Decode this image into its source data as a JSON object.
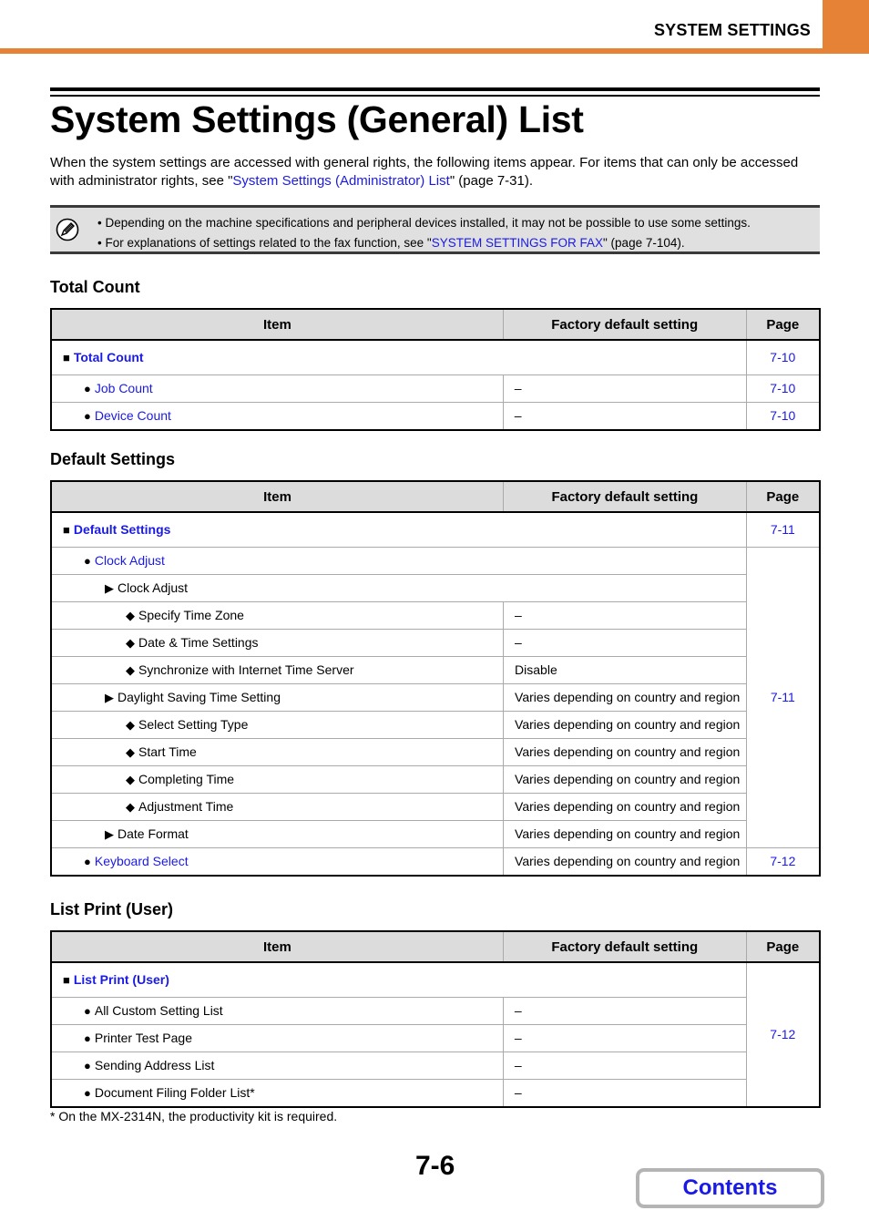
{
  "header": {
    "section": "SYSTEM SETTINGS",
    "accent_color": "#e68235"
  },
  "title": "System Settings (General) List",
  "intro": {
    "before": "When the system settings are accessed with general rights, the following items appear. For items that can only be accessed with administrator rights, see \"",
    "link": "System Settings (Administrator) List",
    "after": "\" (page 7-31)."
  },
  "note": {
    "icon": "pencil-note-icon",
    "line1": "• Depending on the machine specifications and peripheral devices installed, it may not be possible to use some settings.",
    "line2_before": "• For explanations of settings related to the fax function, see \"",
    "line2_link": "SYSTEM SETTINGS FOR FAX",
    "line2_after": "\" (page 7-104)."
  },
  "columns": {
    "item": "Item",
    "default": "Factory default setting",
    "page": "Page"
  },
  "sections": {
    "total_count": {
      "heading": "Total Count",
      "rows": [
        {
          "level": 0,
          "glyph": "■",
          "label": "Total Count",
          "link": true,
          "page": "7-10"
        },
        {
          "level": 1,
          "glyph": "●",
          "label": "Job Count",
          "link": true,
          "default": "–",
          "page": "7-10"
        },
        {
          "level": 1,
          "glyph": "●",
          "label": "Device Count",
          "link": true,
          "default": "–",
          "page": "7-10"
        }
      ]
    },
    "default_settings": {
      "heading": "Default Settings",
      "rows": [
        {
          "level": 0,
          "glyph": "■",
          "label": "Default Settings",
          "link": true,
          "page": "7-11"
        },
        {
          "level": 1,
          "glyph": "●",
          "label": "Clock Adjust",
          "link": true
        },
        {
          "level": 2,
          "glyph": "▶",
          "label": "Clock Adjust"
        },
        {
          "level": 3,
          "glyph": "◆",
          "label": "Specify Time Zone",
          "default": "–"
        },
        {
          "level": 3,
          "glyph": "◆",
          "label": "Date & Time Settings",
          "default": "–"
        },
        {
          "level": 3,
          "glyph": "◆",
          "label": "Synchronize with Internet Time Server",
          "default": "Disable"
        },
        {
          "level": 2,
          "glyph": "▶",
          "label": "Daylight Saving Time Setting",
          "default": "Varies depending on country and region"
        },
        {
          "level": 3,
          "glyph": "◆",
          "label": "Select Setting Type",
          "default": "Varies depending on country and region"
        },
        {
          "level": 3,
          "glyph": "◆",
          "label": "Start Time",
          "default": "Varies depending on country and region"
        },
        {
          "level": 3,
          "glyph": "◆",
          "label": "Completing Time",
          "default": "Varies depending on country and region"
        },
        {
          "level": 3,
          "glyph": "◆",
          "label": "Adjustment Time",
          "default": "Varies depending on country and region"
        },
        {
          "level": 2,
          "glyph": "▶",
          "label": "Date Format",
          "default": "Varies depending on country and region"
        },
        {
          "level": 1,
          "glyph": "●",
          "label": "Keyboard Select",
          "link": true,
          "default": "Varies depending on country and region",
          "page": "7-12"
        }
      ],
      "clock_adjust_page": "7-11"
    },
    "list_print": {
      "heading": "List Print (User)",
      "rows": [
        {
          "level": 0,
          "glyph": "■",
          "label": "List Print (User)",
          "link": true
        },
        {
          "level": 1,
          "glyph": "●",
          "label": "All Custom Setting List",
          "default": "–"
        },
        {
          "level": 1,
          "glyph": "●",
          "label": "Printer Test Page",
          "default": "–"
        },
        {
          "level": 1,
          "glyph": "●",
          "label": "Sending Address List",
          "default": "–"
        },
        {
          "level": 1,
          "glyph": "●",
          "label": "Document Filing Folder List*",
          "default": "–"
        }
      ],
      "page": "7-12"
    }
  },
  "footnote": "*  On the MX-2314N, the productivity kit is required.",
  "page_number": "7-6",
  "contents_button": "Contents"
}
